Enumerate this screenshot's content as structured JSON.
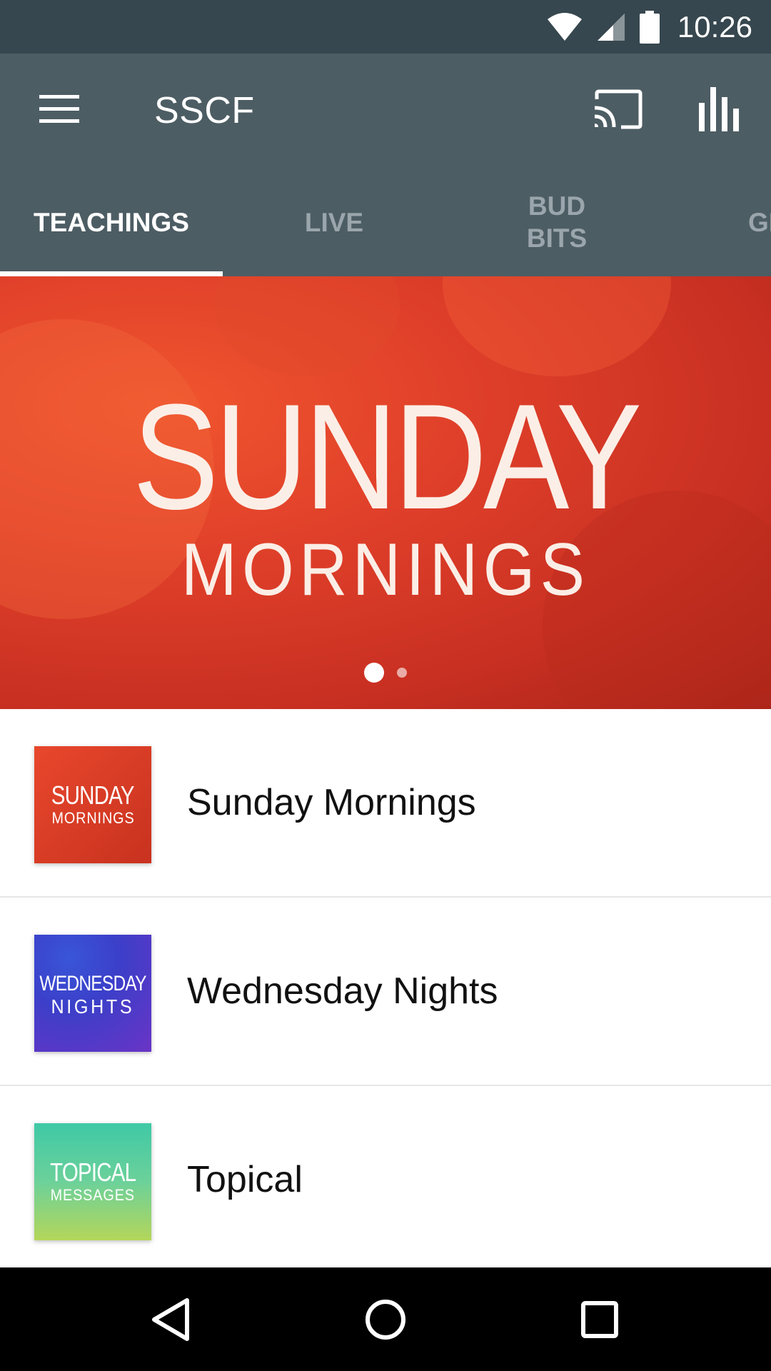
{
  "status_bar": {
    "time": "10:26",
    "icons": [
      "wifi-icon",
      "cell-signal-icon",
      "battery-icon"
    ]
  },
  "app_bar": {
    "title": "SSCF",
    "actions": [
      "menu-icon",
      "cast-icon",
      "stats-icon"
    ]
  },
  "tabs": [
    {
      "label": "TEACHINGS",
      "active": true
    },
    {
      "label": "LIVE",
      "active": false
    },
    {
      "label": "BUD\nBITS",
      "active": false
    },
    {
      "label": "GI",
      "active": false
    }
  ],
  "hero": {
    "title_line1": "SUNDAY",
    "title_line2": "MORNINGS",
    "pager_count": 2,
    "pager_active": 1
  },
  "items": [
    {
      "label": "Sunday Mornings",
      "thumb_line1": "SUNDAY",
      "thumb_line2": "MORNINGS",
      "thumb_colors": [
        "#e8472c",
        "#c8321f"
      ]
    },
    {
      "label": "Wednesday Nights",
      "thumb_line1": "WEDNESDAY",
      "thumb_line2": "NIGHTS",
      "thumb_colors": [
        "#3b3fc9",
        "#7a34c2"
      ]
    },
    {
      "label": "Topical",
      "thumb_line1": "TOPICAL",
      "thumb_line2": "MESSAGES",
      "thumb_colors": [
        "#43c9a0",
        "#a9d45a"
      ]
    }
  ],
  "colors": {
    "status_bar": "#37474f",
    "app_bar": "#4d5d64",
    "tab_active": "#ffffff",
    "tab_inactive": "#9aa6ab",
    "hero_accent": "#e0402a"
  },
  "nav_bar": {
    "buttons": [
      "back-icon",
      "home-icon",
      "recents-icon"
    ]
  }
}
